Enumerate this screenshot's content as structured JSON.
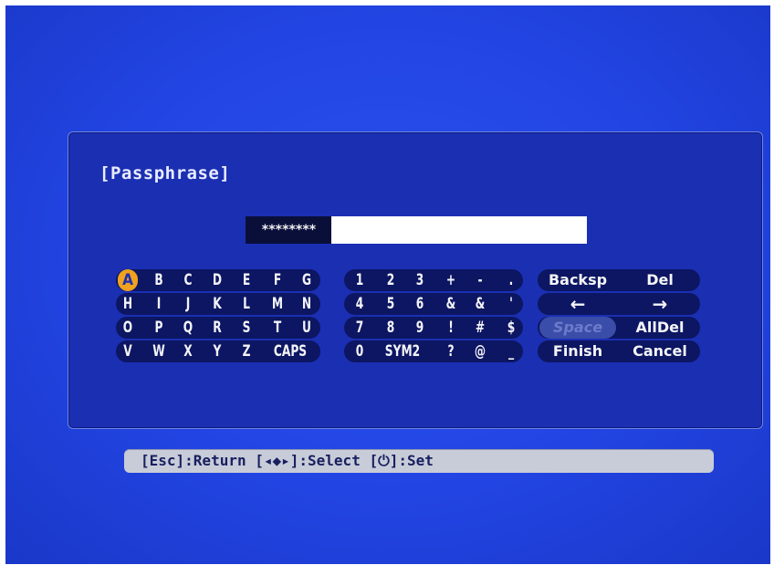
{
  "dialog": {
    "title": "[Passphrase]",
    "passphrase_mask": "********"
  },
  "keyboard": {
    "letters": [
      [
        "A",
        "B",
        "C",
        "D",
        "E",
        "F",
        "G"
      ],
      [
        "H",
        "I",
        "J",
        "K",
        "L",
        "M",
        "N"
      ],
      [
        "O",
        "P",
        "Q",
        "R",
        "S",
        "T",
        "U"
      ],
      [
        "V",
        "W",
        "X",
        "Y",
        "Z",
        "CAPS"
      ]
    ],
    "symbols": [
      [
        "1",
        "2",
        "3",
        "+",
        "-",
        "."
      ],
      [
        "4",
        "5",
        "6",
        "&",
        "&",
        "'"
      ],
      [
        "7",
        "8",
        "9",
        "!",
        "#",
        "$"
      ],
      [
        "0",
        "SYM2",
        "?",
        "@",
        "_"
      ]
    ],
    "functions": {
      "backsp": "Backsp",
      "del": "Del",
      "left": "←",
      "right": "→",
      "space": "Space",
      "alldel": "AllDel",
      "finish": "Finish",
      "cancel": "Cancel"
    },
    "selected_key": "A",
    "selected_color": "#f0a21e"
  },
  "help": {
    "text": "[Esc]:Return [◂◆▸]:Select [⏻]:Set"
  }
}
